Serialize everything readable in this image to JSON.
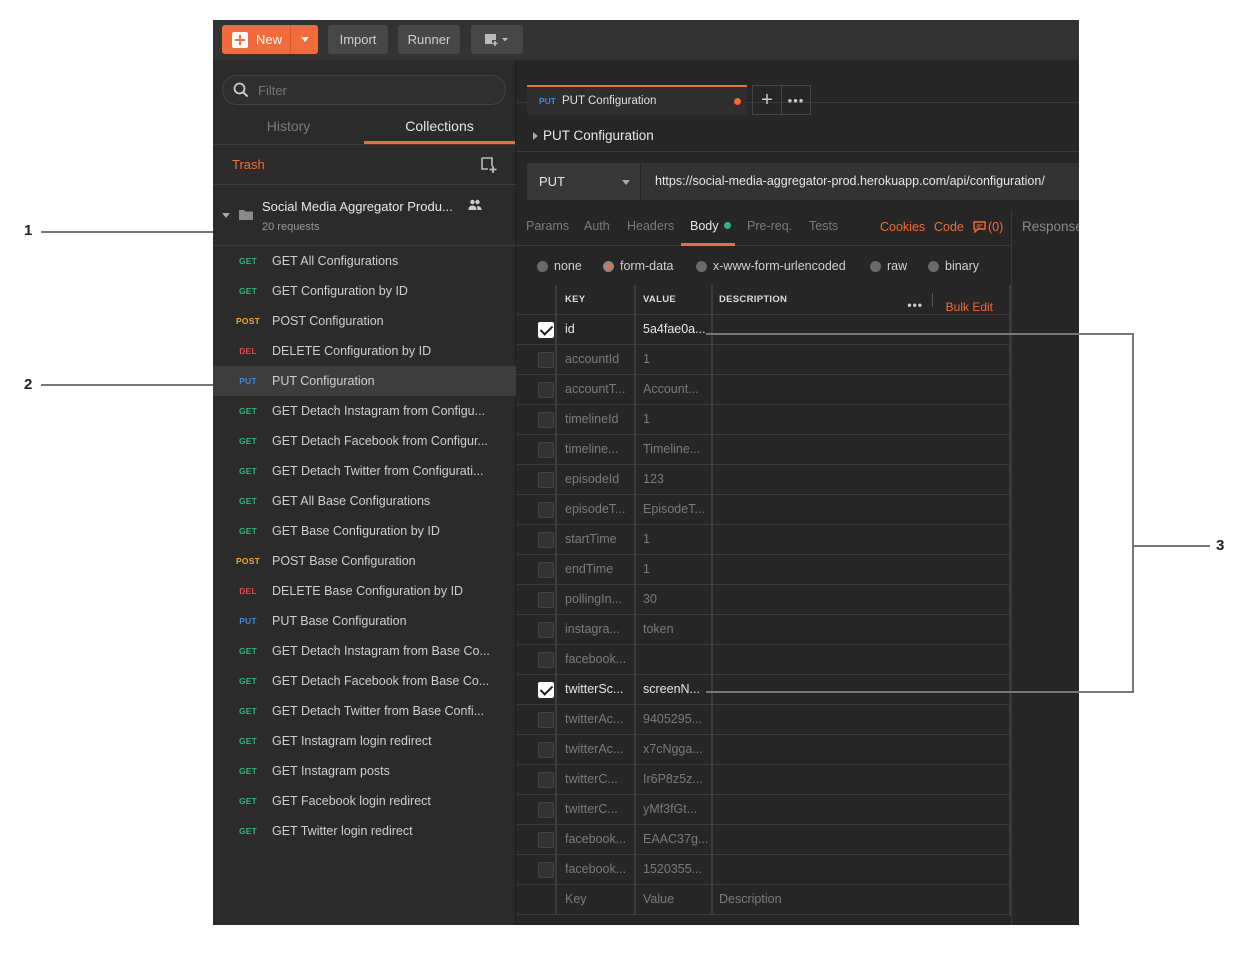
{
  "annotations": [
    "1",
    "2",
    "3"
  ],
  "toolbar": {
    "new_label": "New",
    "import_label": "Import",
    "runner_label": "Runner"
  },
  "sidebar": {
    "filter_placeholder": "Filter",
    "tabs": [
      "History",
      "Collections"
    ],
    "trash_label": "Trash",
    "collection": {
      "name": "Social Media Aggregator Produ...",
      "count": "20 requests"
    },
    "requests": [
      {
        "method": "GET",
        "name": "GET All Configurations"
      },
      {
        "method": "GET",
        "name": "GET Configuration by ID"
      },
      {
        "method": "POST",
        "name": "POST Configuration"
      },
      {
        "method": "DEL",
        "name": "DELETE Configuration by ID"
      },
      {
        "method": "PUT",
        "name": "PUT Configuration"
      },
      {
        "method": "GET",
        "name": "GET Detach Instagram from Configu..."
      },
      {
        "method": "GET",
        "name": "GET Detach Facebook from Configur..."
      },
      {
        "method": "GET",
        "name": "GET Detach Twitter from Configurati..."
      },
      {
        "method": "GET",
        "name": "GET All Base Configurations"
      },
      {
        "method": "GET",
        "name": "GET Base Configuration by ID"
      },
      {
        "method": "POST",
        "name": "POST Base Configuration"
      },
      {
        "method": "DEL",
        "name": "DELETE Base Configuration by ID"
      },
      {
        "method": "PUT",
        "name": "PUT Base Configuration"
      },
      {
        "method": "GET",
        "name": "GET Detach Instagram from Base Co..."
      },
      {
        "method": "GET",
        "name": "GET Detach Facebook from Base Co..."
      },
      {
        "method": "GET",
        "name": "GET Detach Twitter from Base Confi..."
      },
      {
        "method": "GET",
        "name": "GET Instagram login redirect"
      },
      {
        "method": "GET",
        "name": "GET Instagram posts"
      },
      {
        "method": "GET",
        "name": "GET Facebook login redirect"
      },
      {
        "method": "GET",
        "name": "GET Twitter login redirect"
      }
    ],
    "active_index": 4
  },
  "method_colors": {
    "GET": "#2fb67c",
    "POST": "#f5a623",
    "DEL": "#e04b4b",
    "PUT": "#3a8bd9"
  },
  "main": {
    "tab": {
      "method": "PUT",
      "title": "PUT Configuration"
    },
    "request_title": "PUT Configuration",
    "method": "PUT",
    "url": "https://social-media-aggregator-prod.herokuapp.com/api/configuration/",
    "subtabs": {
      "params": "Params",
      "auth": "Auth",
      "headers": "Headers",
      "body": "Body",
      "prereq": "Pre-req.",
      "tests": "Tests",
      "cookies": "Cookies",
      "code": "Code",
      "comments": "(0)"
    },
    "response_label": "Response",
    "body_modes": [
      "none",
      "form-data",
      "x-www-form-urlencoded",
      "raw",
      "binary"
    ],
    "selected_mode": "form-data",
    "table": {
      "headers": {
        "key": "KEY",
        "value": "VALUE",
        "description": "DESCRIPTION",
        "bulk_edit": "Bulk Edit"
      },
      "rows": [
        {
          "key": "id",
          "value": "5a4fae0a...",
          "checked": true
        },
        {
          "key": "accountId",
          "value": "1",
          "checked": false
        },
        {
          "key": "accountT...",
          "value": "Account...",
          "checked": false
        },
        {
          "key": "timelineId",
          "value": "1",
          "checked": false
        },
        {
          "key": "timeline...",
          "value": "Timeline...",
          "checked": false
        },
        {
          "key": "episodeId",
          "value": "123",
          "checked": false
        },
        {
          "key": "episodeT...",
          "value": "EpisodeT...",
          "checked": false
        },
        {
          "key": "startTime",
          "value": "1",
          "checked": false
        },
        {
          "key": "endTime",
          "value": "1",
          "checked": false
        },
        {
          "key": "pollingIn...",
          "value": "30",
          "checked": false
        },
        {
          "key": "instagra...",
          "value": "token",
          "checked": false
        },
        {
          "key": "facebook...",
          "value": "",
          "checked": false
        },
        {
          "key": "twitterSc...",
          "value": "screenN...",
          "checked": true
        },
        {
          "key": "twitterAc...",
          "value": "9405295...",
          "checked": false
        },
        {
          "key": "twitterAc...",
          "value": "x7cNgga...",
          "checked": false
        },
        {
          "key": "twitterC...",
          "value": "Ir6P8z5z...",
          "checked": false
        },
        {
          "key": "twitterC...",
          "value": "yMf3fGt...",
          "checked": false
        },
        {
          "key": "facebook...",
          "value": "EAAC37g...",
          "checked": false
        },
        {
          "key": "facebook...",
          "value": "1520355...",
          "checked": false
        }
      ],
      "placeholder": {
        "key": "Key",
        "value": "Value",
        "description": "Description"
      }
    }
  }
}
